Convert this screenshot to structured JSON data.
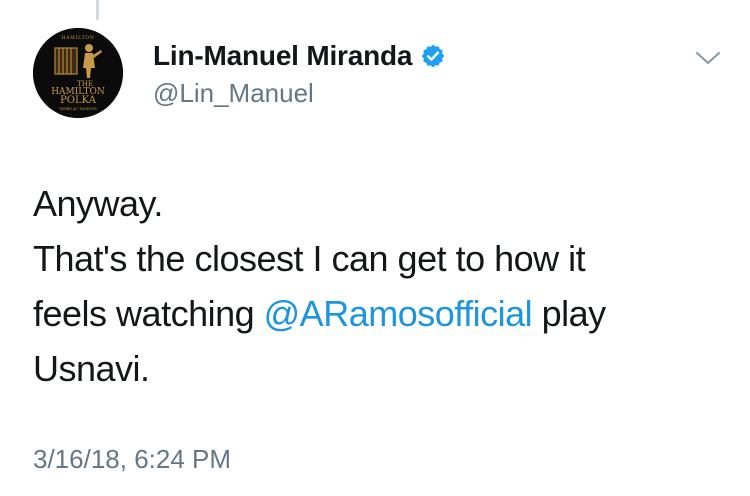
{
  "author": {
    "display_name": "Lin-Manuel Miranda",
    "handle": "@Lin_Manuel",
    "verified": true,
    "avatar": {
      "top_text": "HAMILTON",
      "line1": "THE",
      "line2": "HAMILTON",
      "line3": "POLKA",
      "bottom_text": "\"WEIRD AL\" YANKOVIC"
    }
  },
  "tweet": {
    "line1": "Anyway.",
    "line2": "That's the closest I can get to how it",
    "line3_prefix": "feels watching ",
    "mention": "@ARamosofficial",
    "line3_suffix": " play",
    "line4": "Usnavi.",
    "timestamp": "3/16/18, 6:24 PM"
  },
  "icons": {
    "verified": "verified-badge-icon",
    "menu": "chevron-down-icon"
  },
  "colors": {
    "text": "#14171a",
    "secondary": "#657786",
    "link": "#1b95e0",
    "verified": "#1da1f2"
  }
}
